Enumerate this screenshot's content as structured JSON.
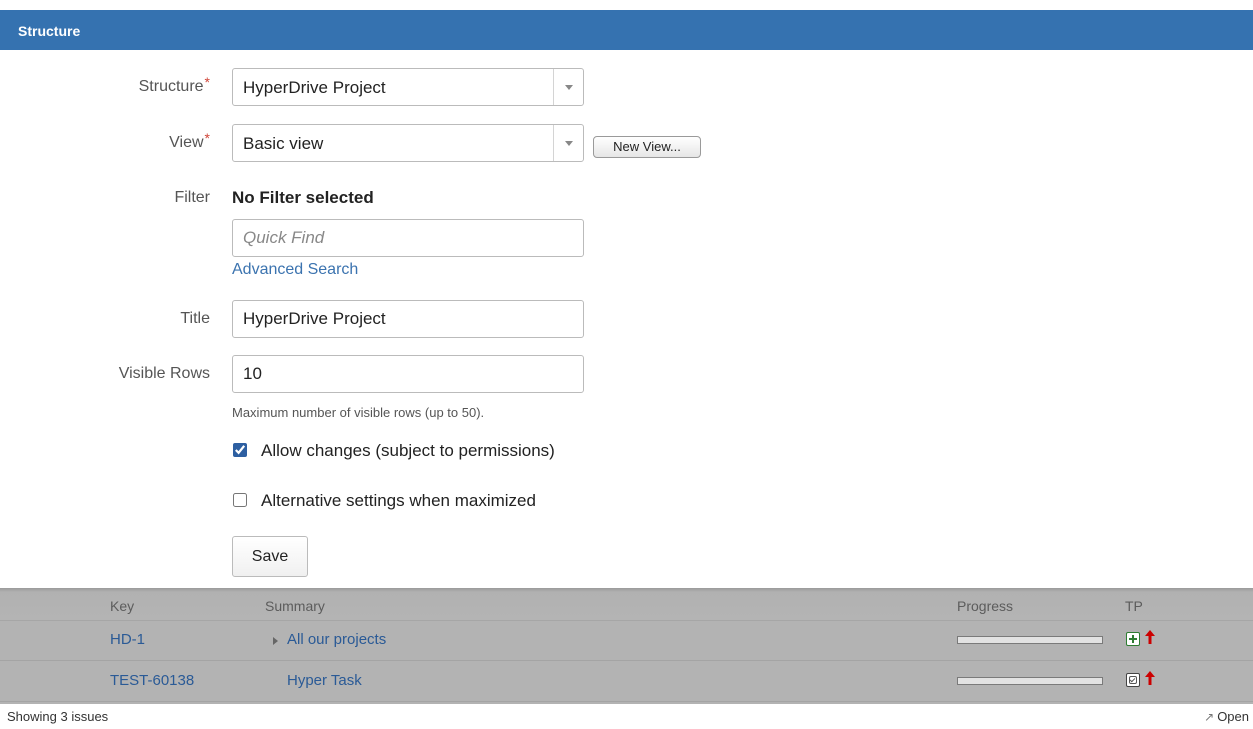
{
  "header": {
    "title": "Structure"
  },
  "form": {
    "structure": {
      "label": "Structure",
      "required": "*",
      "value": "HyperDrive Project"
    },
    "view": {
      "label": "View",
      "required": "*",
      "value": "Basic view",
      "new_view_button": "New View..."
    },
    "filter": {
      "label": "Filter",
      "value": "No Filter selected",
      "quick_find_placeholder": "Quick Find",
      "advanced_search_link": "Advanced Search"
    },
    "title": {
      "label": "Title",
      "value": "HyperDrive Project"
    },
    "visible_rows": {
      "label": "Visible Rows",
      "value": "10",
      "help": "Maximum number of visible rows (up to 50)."
    },
    "allow_changes": {
      "label": "Allow changes (subject to permissions)",
      "checked": true
    },
    "alternative_settings": {
      "label": "Alternative settings when maximized",
      "checked": false
    },
    "save_button": "Save"
  },
  "grid": {
    "columns": {
      "key": "Key",
      "summary": "Summary",
      "progress": "Progress",
      "tp": "TP"
    },
    "rows": [
      {
        "key": "HD-1",
        "summary": "All our projects",
        "expandable": true,
        "progress": 0,
        "type_icon": "new-feature-icon",
        "priority_icon": "priority-up-arrow-icon"
      },
      {
        "key": "TEST-60138",
        "summary": "Hyper Task",
        "expandable": false,
        "progress": 0,
        "type_icon": "task-icon",
        "priority_icon": "priority-up-arrow-icon"
      }
    ]
  },
  "footer": {
    "status": "Showing 3 issues",
    "open_link": "Open"
  },
  "colors": {
    "header": "#3572b0",
    "link": "#3b73af",
    "required": "#d04437",
    "priority": "#cc0000",
    "new_feature": "#2e7d32"
  }
}
